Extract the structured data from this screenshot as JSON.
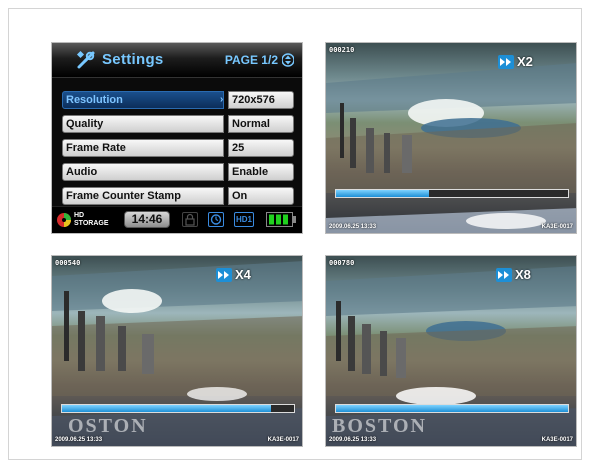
{
  "settings": {
    "title": "Settings",
    "page": "PAGE 1/2",
    "rows": [
      {
        "label": "Resolution",
        "value": "720x576",
        "selected": true
      },
      {
        "label": "Quality",
        "value": "Normal",
        "selected": false
      },
      {
        "label": "Frame Rate",
        "value": "25",
        "selected": false
      },
      {
        "label": "Audio",
        "value": "Enable",
        "selected": false
      },
      {
        "label": "Frame Counter Stamp",
        "value": "On",
        "selected": false
      }
    ],
    "footer": {
      "hd_line1": "HD",
      "hd_line2": "STORAGE",
      "time": "14:46",
      "hd_badge": "HD1"
    }
  },
  "playback": [
    {
      "counter": "000210",
      "speed": "X2",
      "progress": 0.4,
      "date": "2009.06.25  13:33",
      "id": "KA3E-0017",
      "caption": ""
    },
    {
      "counter": "000540",
      "speed": "X4",
      "progress": 0.9,
      "date": "2009.06.25  13:33",
      "id": "KA3E-0017",
      "caption": "OSTON"
    },
    {
      "counter": "000780",
      "speed": "X8",
      "progress": 1.0,
      "date": "2009.06.25  13:33",
      "id": "KA3E-0017",
      "caption": "BOSTON"
    }
  ],
  "colors": {
    "accent": "#1d8fd6",
    "title_blue": "#78c8ff",
    "battery_green": "#21d11f"
  },
  "icons": [
    "wrench-icon",
    "page-arrows-icon",
    "hd-storage-icon",
    "lock-icon",
    "timer-icon",
    "hd1-icon",
    "battery-icon",
    "fast-forward-icon"
  ]
}
